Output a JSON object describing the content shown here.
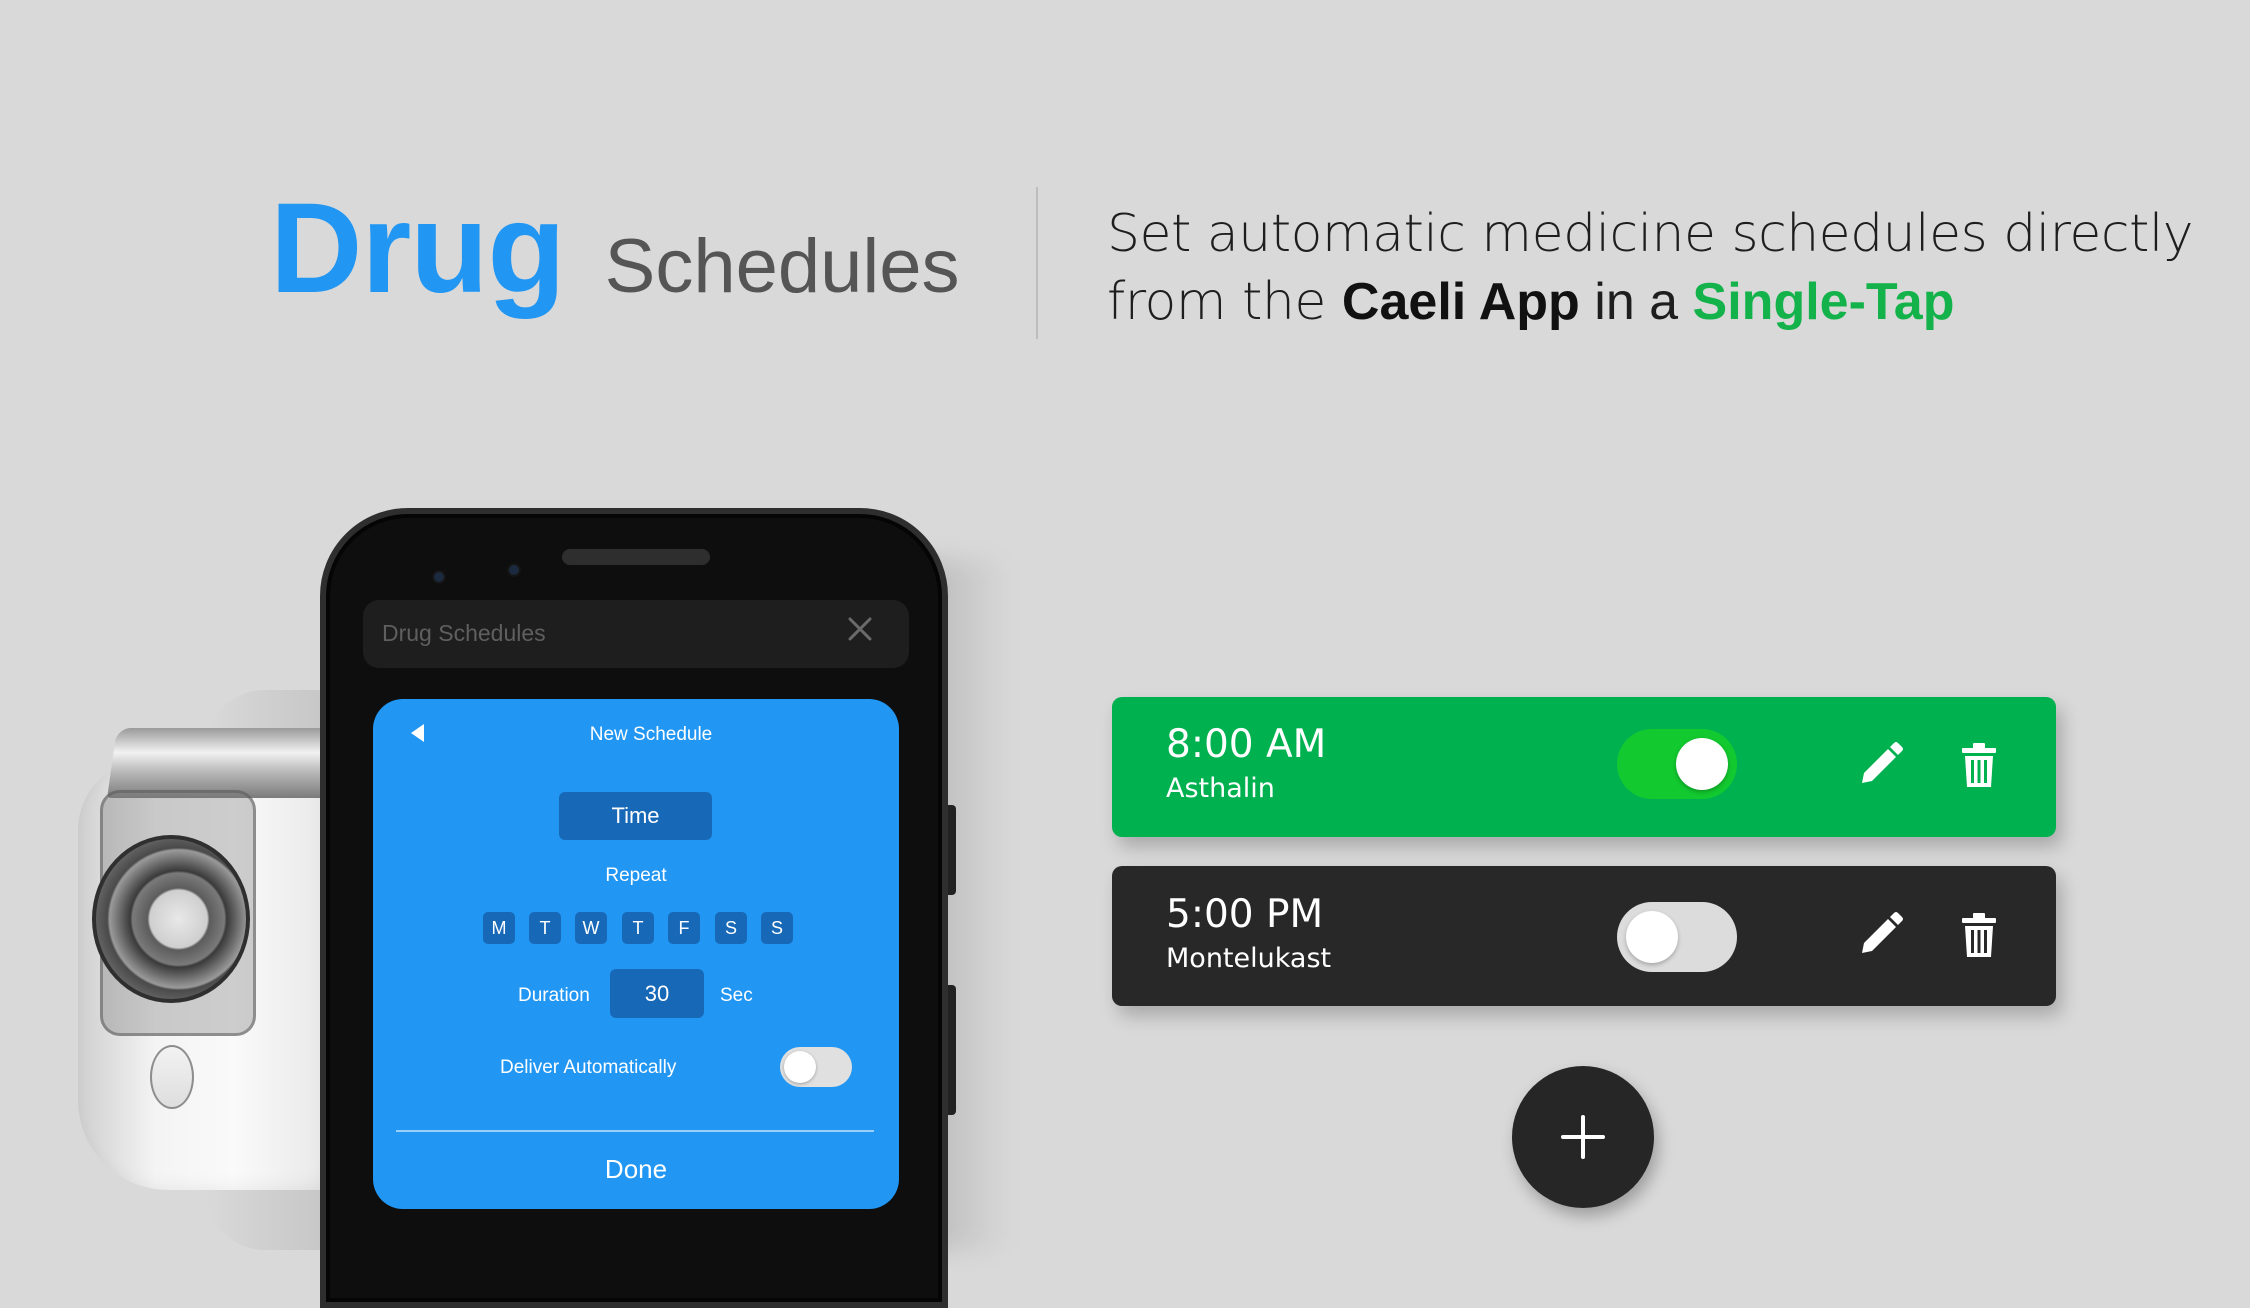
{
  "headline": {
    "title_bold": "Drug",
    "title_rest": "Schedules"
  },
  "tagline": {
    "line1": "Set automatic medicine schedules directly",
    "line2_prefix": "from the ",
    "app_name": "Caeli App",
    "line2_middle": " in a ",
    "highlight": "Single-Tap"
  },
  "phone": {
    "app_bar_title": "Drug Schedules",
    "close_icon": "close-icon",
    "modal": {
      "title": "New Schedule",
      "time_button": "Time",
      "repeat_label": "Repeat",
      "days": [
        "M",
        "T",
        "W",
        "T",
        "F",
        "S",
        "S"
      ],
      "duration_label": "Duration",
      "duration_value": "30",
      "duration_unit": "Sec",
      "deliver_label": "Deliver Automatically",
      "deliver_enabled": false,
      "done_label": "Done"
    }
  },
  "schedules": [
    {
      "time": "8:00 AM",
      "drug": "Asthalin",
      "enabled": true,
      "color": "#00b14f"
    },
    {
      "time": "5:00 PM",
      "drug": "Montelukast",
      "enabled": false,
      "color": "#282828"
    }
  ],
  "icons": {
    "edit": "pencil-icon",
    "delete": "trash-icon",
    "add": "plus-icon"
  },
  "colors": {
    "accent_blue": "#2196f3",
    "accent_green": "#13b24a",
    "background": "#d9d9d9"
  }
}
